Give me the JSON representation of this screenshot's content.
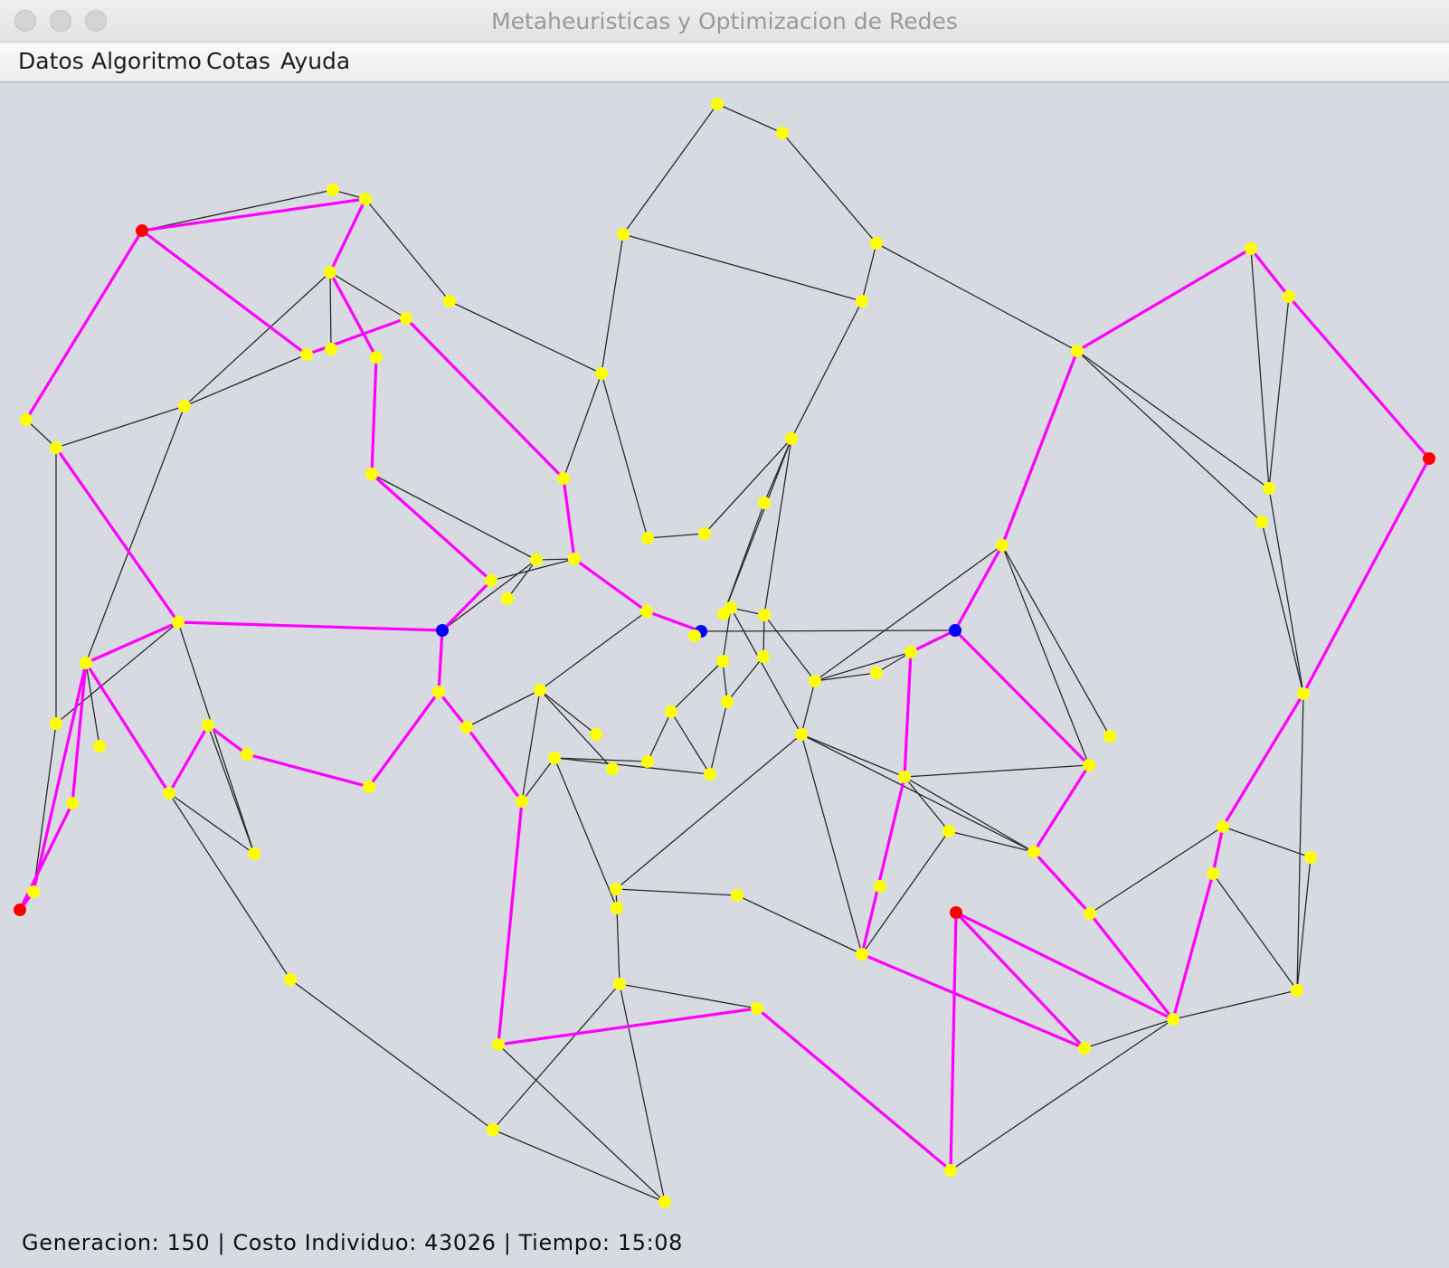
{
  "window": {
    "title": "Metaheuristicas y Optimizacion de Redes"
  },
  "menu": {
    "items": [
      "Datos",
      "Algoritmo",
      "Cotas",
      "Ayuda"
    ]
  },
  "status": {
    "generacion_label": "Generacion:",
    "generacion": "150",
    "costo_label": "Costo Individuo:",
    "costo": "43026",
    "tiempo_label": "Tiempo:",
    "tiempo": "15:08",
    "separator": "|"
  },
  "colors": {
    "node": "#ffff00",
    "terminal": "#ff0000",
    "steiner": "#0000ff",
    "tree_edge": "#ff00ff",
    "graph_edge": "#2a2a2a",
    "canvas": "#d7dae1"
  }
}
